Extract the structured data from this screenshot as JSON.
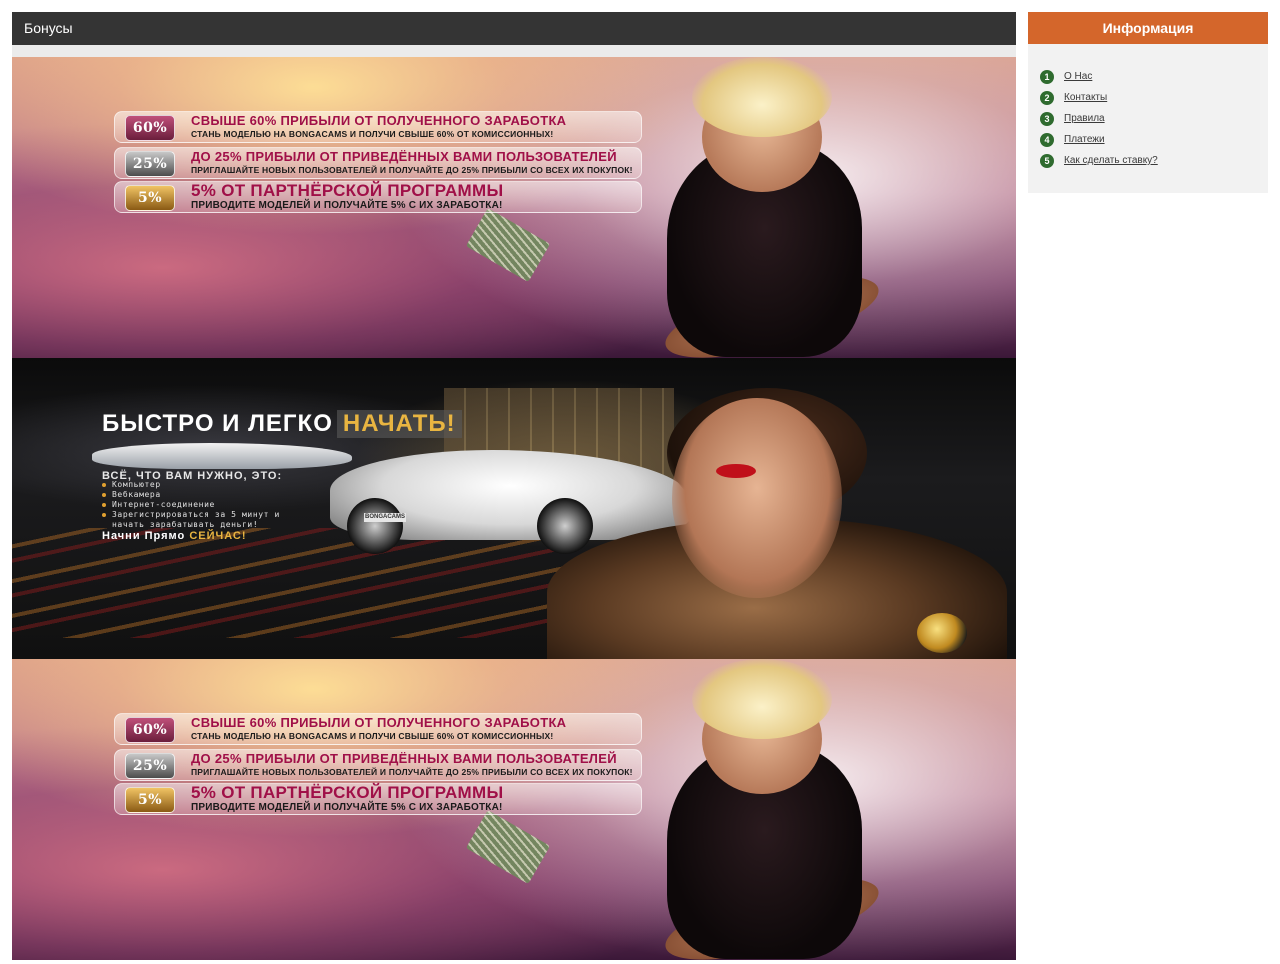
{
  "main": {
    "section_title": "Бонусы"
  },
  "promo": {
    "rows": [
      {
        "badge": "60%",
        "title": "СВЫШЕ 60% ПРИБЫЛИ ОТ ПОЛУЧЕННОГО ЗАРАБОТКА",
        "subtitle": "СТАНЬ МОДЕЛЬЮ НА BONGACAMS И ПОЛУЧИ СВЫШЕ 60% ОТ КОМИССИОННЫХ!"
      },
      {
        "badge": "25%",
        "title": "ДО 25% ПРИБЫЛИ ОТ ПРИВЕДЁННЫХ ВАМИ ПОЛЬЗОВАТЕЛЕЙ",
        "subtitle": "ПРИГЛАШАЙТЕ НОВЫХ ПОЛЬЗОВАТЕЛЕЙ И ПОЛУЧАЙТЕ ДО 25% ПРИБЫЛИ СО ВСЕХ ИХ ПОКУПОК!"
      },
      {
        "badge": "5%",
        "title": "5% ОТ ПАРТНЁРСКОЙ ПРОГРАММЫ",
        "subtitle": "ПРИВОДИТЕ МОДЕЛЕЙ И ПОЛУЧАЙТЕ 5% С ИХ ЗАРАБОТКА!"
      }
    ]
  },
  "start": {
    "title": "БЫСТРО И ЛЕГКО",
    "title_accent": "НАЧАТЬ!",
    "lead": "ВСЁ, ЧТО ВАМ НУЖНО, ЭТО:",
    "items": [
      "Компьютер",
      "Вебкамера",
      "Интернет-соединение",
      "Зарегистрироваться за 5 минут и",
      "начать зарабатывать деньги!"
    ],
    "cta": "Начни Прямо",
    "cta_accent": "СЕЙЧАС!",
    "plate": "BONGACAMS"
  },
  "sidebar": {
    "title": "Информация",
    "items": [
      {
        "num": "1",
        "label": "О Нас"
      },
      {
        "num": "2",
        "label": "Контакты"
      },
      {
        "num": "3",
        "label": "Правила"
      },
      {
        "num": "4",
        "label": "Платежи"
      },
      {
        "num": "5",
        "label": "Как сделать ставку?"
      }
    ]
  },
  "colors": {
    "header_bg": "#343434",
    "sidebar_header_bg": "#d4662b",
    "number_bullet": "#2f6b2f"
  }
}
